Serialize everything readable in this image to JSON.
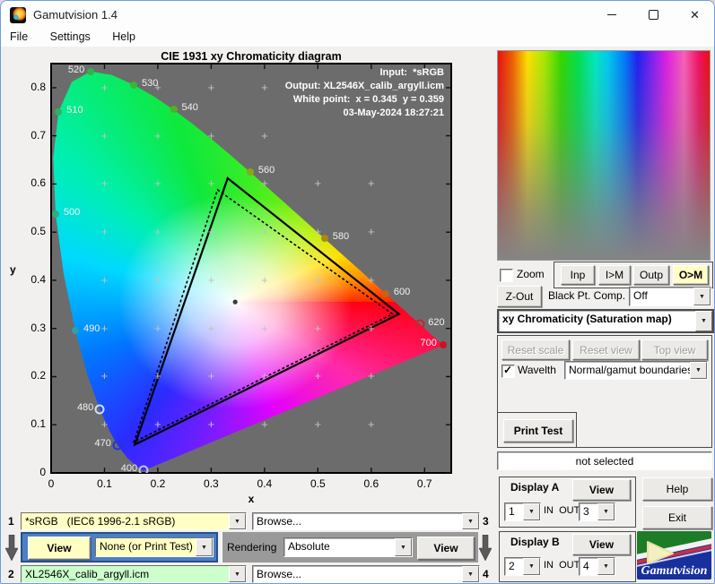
{
  "window": {
    "title": "Gamutvision 1.4"
  },
  "icons": {
    "minimize": "minimize",
    "maximize": "maximize",
    "close": "✕",
    "dropdown": "▼"
  },
  "menu": {
    "items": [
      "File",
      "Settings",
      "Help"
    ]
  },
  "chart_data": {
    "type": "chromaticity-diagram",
    "title": "CIE 1931 xy Chromaticity diagram",
    "xlabel": "x",
    "ylabel": "y",
    "x_range": [
      0,
      0.75
    ],
    "y_range": [
      0,
      0.85
    ],
    "x_ticks": [
      0,
      0.1,
      0.2,
      0.3,
      0.4,
      0.5,
      0.6,
      0.7
    ],
    "y_ticks": [
      0,
      0.1,
      0.2,
      0.3,
      0.4,
      0.5,
      0.6,
      0.7,
      0.8
    ],
    "annotation": [
      "Input:  *sRGB",
      "Output: XL2546X_calib_argyll.icm",
      "White point:  x = 0.345  y = 0.359",
      "03-May-2024 18:27:21"
    ],
    "white_point": {
      "x": 0.345,
      "y": 0.355
    },
    "gamut_output_solid": [
      [
        0.652,
        0.33
      ],
      [
        0.331,
        0.612
      ],
      [
        0.157,
        0.059
      ]
    ],
    "gamut_input_dotted": [
      [
        0.64,
        0.33
      ],
      [
        0.312,
        0.588
      ],
      [
        0.155,
        0.064
      ]
    ],
    "wavelengths": [
      {
        "nm": "520",
        "x": 0.0743,
        "y": 0.8338,
        "side": "left",
        "dot": "fill",
        "c": "#2fb44a"
      },
      {
        "nm": "530",
        "x": 0.1547,
        "y": 0.8059,
        "side": "right",
        "dot": "fill",
        "c": "#3cb437"
      },
      {
        "nm": "540",
        "x": 0.2296,
        "y": 0.7543,
        "side": "right",
        "dot": "fill",
        "c": "#52b028"
      },
      {
        "nm": "510",
        "x": 0.0139,
        "y": 0.7502,
        "side": "right",
        "dot": "fill",
        "c": "#2cb45e"
      },
      {
        "nm": "500",
        "x": 0.0082,
        "y": 0.5384,
        "side": "right",
        "dot": "fill",
        "c": "#2aae85"
      },
      {
        "nm": "490",
        "x": 0.0454,
        "y": 0.295,
        "side": "right",
        "dot": "fill",
        "c": "#2f9fae"
      },
      {
        "nm": "480",
        "x": 0.0913,
        "y": 0.1327,
        "side": "left",
        "dot": "open",
        "c": "#cfe0ff"
      },
      {
        "nm": "470",
        "x": 0.1241,
        "y": 0.0578,
        "side": "left",
        "dot": "open",
        "c": "#2633d6"
      },
      {
        "nm": "400",
        "x": 0.1733,
        "y": 0.0048,
        "side": "left",
        "dot": "open",
        "c": "#b9c4f2"
      },
      {
        "nm": "560",
        "x": 0.3731,
        "y": 0.6245,
        "side": "right",
        "dot": "fill",
        "c": "#8aa714"
      },
      {
        "nm": "580",
        "x": 0.5125,
        "y": 0.4866,
        "side": "right",
        "dot": "fill",
        "c": "#a98a10"
      },
      {
        "nm": "600",
        "x": 0.627,
        "y": 0.3725,
        "side": "right",
        "dot": "fill",
        "c": "#c2641c"
      },
      {
        "nm": "620",
        "x": 0.6915,
        "y": 0.3083,
        "side": "right",
        "dot": "open",
        "c": "#cc2430"
      },
      {
        "nm": "700",
        "x": 0.7347,
        "y": 0.2653,
        "side": "left",
        "dot": "fill",
        "c": "#cc1122"
      }
    ],
    "locus": [
      [
        0.1741,
        0.005
      ],
      [
        0.1733,
        0.0048
      ],
      [
        0.1726,
        0.0048
      ],
      [
        0.1714,
        0.0051
      ],
      [
        0.1689,
        0.0069
      ],
      [
        0.1644,
        0.0109
      ],
      [
        0.1566,
        0.0177
      ],
      [
        0.144,
        0.0297
      ],
      [
        0.1241,
        0.0578
      ],
      [
        0.1096,
        0.0868
      ],
      [
        0.0913,
        0.1327
      ],
      [
        0.0687,
        0.2007
      ],
      [
        0.0454,
        0.295
      ],
      [
        0.0235,
        0.4127
      ],
      [
        0.0082,
        0.5384
      ],
      [
        0.0039,
        0.6548
      ],
      [
        0.0139,
        0.7502
      ],
      [
        0.0389,
        0.812
      ],
      [
        0.0743,
        0.8338
      ],
      [
        0.1142,
        0.8262
      ],
      [
        0.1547,
        0.8059
      ],
      [
        0.1929,
        0.7816
      ],
      [
        0.2296,
        0.7543
      ],
      [
        0.2658,
        0.7243
      ],
      [
        0.3016,
        0.6923
      ],
      [
        0.3373,
        0.6589
      ],
      [
        0.3731,
        0.6245
      ],
      [
        0.4087,
        0.5896
      ],
      [
        0.4441,
        0.5547
      ],
      [
        0.4788,
        0.5202
      ],
      [
        0.5125,
        0.4866
      ],
      [
        0.5448,
        0.4544
      ],
      [
        0.5752,
        0.4242
      ],
      [
        0.6029,
        0.3965
      ],
      [
        0.627,
        0.3725
      ],
      [
        0.6482,
        0.3514
      ],
      [
        0.6658,
        0.334
      ],
      [
        0.6801,
        0.3197
      ],
      [
        0.6915,
        0.3083
      ],
      [
        0.7079,
        0.292
      ],
      [
        0.719,
        0.2809
      ],
      [
        0.726,
        0.274
      ],
      [
        0.7347,
        0.2653
      ]
    ]
  },
  "panel": {
    "zoom_label": "Zoom",
    "inp": "Inp",
    "im": "I>M",
    "outp": "Outp",
    "om": "O>M",
    "zout": "Z-Out",
    "bpc_label": "Black Pt. Comp.",
    "bpc_value": "Off",
    "view_mode": "xy Chromaticity (Saturation map)",
    "reset_scale": "Reset scale",
    "reset_view": "Reset view",
    "top_view": "Top view",
    "wavelth_label": "Wavelth",
    "wavelth_value": "Normal/gamut boundaries",
    "print_test": "Print Test",
    "status": "not selected",
    "display_a": {
      "title": "Display A",
      "view": "View",
      "in": "1",
      "out": "3",
      "inout": "IN  OUT"
    },
    "display_b": {
      "title": "Display B",
      "view": "View",
      "in": "2",
      "out": "4",
      "inout": "IN  OUT"
    },
    "help": "Help",
    "exit": "Exit",
    "logo": "Gamutvision"
  },
  "bottom": {
    "n1": "1",
    "n2": "2",
    "n3": "3",
    "n4": "4",
    "input_profile": "*sRGB   (IEC6 1996-2.1 sRGB)",
    "browse_top": "Browse...",
    "browse_bottom": "Browse...",
    "view_input": "View",
    "simulation": "None (or Print Test)",
    "rendering_label": "Rendering",
    "intent": "Absolute",
    "view_output": "View",
    "output_profile": "XL2546X_calib_argyll.icm"
  },
  "colors": {
    "highlight_yellow": "#ffffc4",
    "profile_yellow": "#ffffc4",
    "profile_green": "#ccffcc",
    "blue_panel": "#4d7fc4",
    "plot_bg": "#6c6c6c"
  }
}
